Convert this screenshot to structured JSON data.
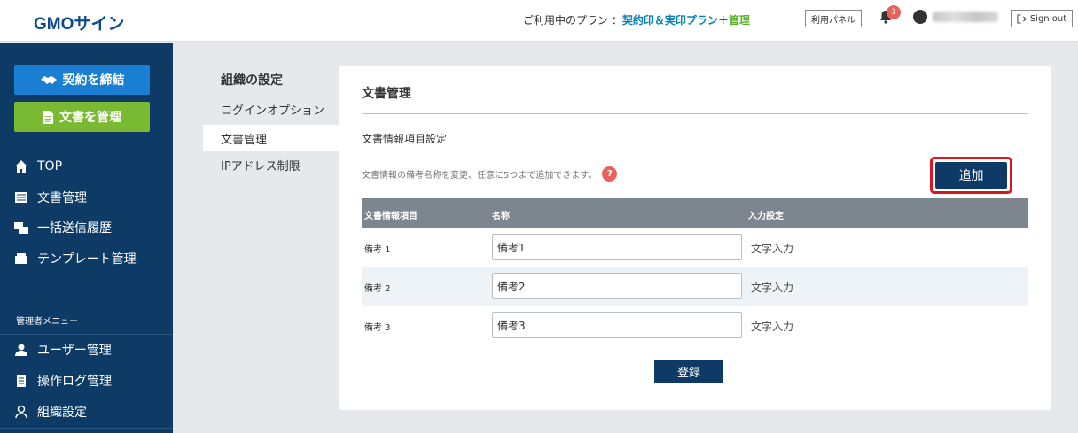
{
  "header": {
    "logo_gmo": "GMO",
    "logo_sign": "サイン",
    "plan_prefix": "ご利用中のプラン ：",
    "plan_name": "契約印＆実印プラン",
    "plan_plus": "＋",
    "plan_admin": "管理",
    "panel_button": "利用パネル",
    "notification_count": "3",
    "sign_out": "Sign out"
  },
  "sidebar": {
    "contract_button": "契約を締結",
    "docs_button": "文書を管理",
    "items": [
      {
        "label": "TOP",
        "icon": "home-icon"
      },
      {
        "label": "文書管理",
        "icon": "document-list-icon"
      },
      {
        "label": "一括送信履歴",
        "icon": "bulk-send-icon"
      },
      {
        "label": "テンプレート管理",
        "icon": "template-icon"
      }
    ],
    "admin_label": "管理者メニュー",
    "admin_items": [
      {
        "label": "ユーザー管理",
        "icon": "user-icon"
      },
      {
        "label": "操作ログ管理",
        "icon": "log-icon"
      },
      {
        "label": "組織設定",
        "icon": "organization-icon"
      }
    ]
  },
  "settings_menu": {
    "title": "組織の設定",
    "items": [
      {
        "label": "ログインオプション",
        "active": false
      },
      {
        "label": "文書管理",
        "active": true
      },
      {
        "label": "IPアドレス制限",
        "active": false
      }
    ]
  },
  "main": {
    "title": "文書管理",
    "section_title": "文書情報項目設定",
    "note": "文書情報の備考名称を変更、任意に5つまで追加できます。",
    "help_icon": "?",
    "add_button": "追加",
    "table": {
      "headers": [
        "文書情報項目",
        "名称",
        "入力設定"
      ],
      "rows": [
        {
          "item": "備考 1",
          "name": "備考1",
          "input_type": "文字入力"
        },
        {
          "item": "備考 2",
          "name": "備考2",
          "input_type": "文字入力"
        },
        {
          "item": "備考 3",
          "name": "備考3",
          "input_type": "文字入力"
        }
      ]
    },
    "register_button": "登録"
  },
  "colors": {
    "sidebar_bg": "#0e3a66",
    "contract_btn": "#1a7fd3",
    "docs_btn": "#7ab932",
    "table_header": "#7d868f",
    "highlight": "#e0141e",
    "badge": "#e8625b"
  }
}
